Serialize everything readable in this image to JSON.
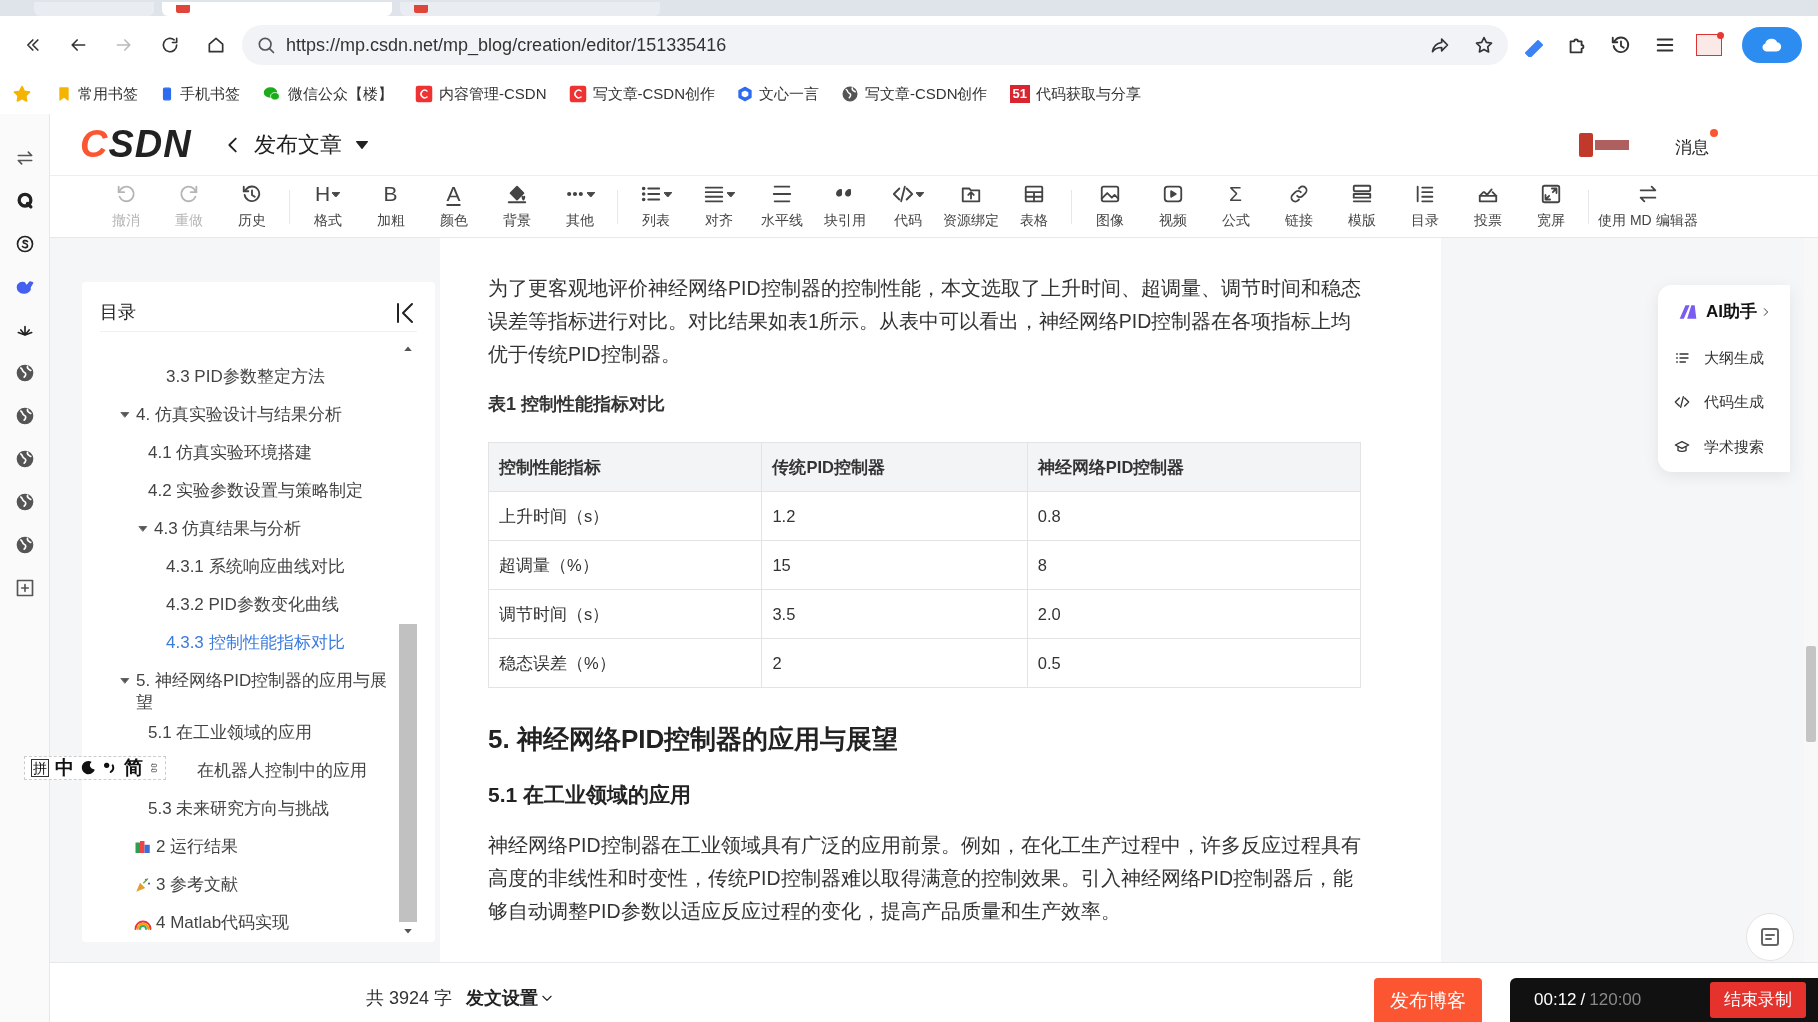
{
  "browser": {
    "tabs": [
      {
        "selected": false
      },
      {
        "selected": true
      },
      {
        "selected": false
      }
    ],
    "url": "https://mp.csdn.net/mp_blog/creation/editor/151335416",
    "bookmarks": [
      {
        "label": "常用书签",
        "kind": "star"
      },
      {
        "label": "手机书签",
        "kind": "phone"
      },
      {
        "label": "微信公众【楼】",
        "kind": "wechat"
      },
      {
        "label": "内容管理-CSDN",
        "kind": "csdn"
      },
      {
        "label": "写文章-CSDN创作",
        "kind": "csdn"
      },
      {
        "label": "文心一言",
        "kind": "cube"
      },
      {
        "label": "写文章-CSDN创作",
        "kind": "globe"
      },
      {
        "label": "代码获取与分享",
        "kind": "badge",
        "badge_text": "51"
      }
    ]
  },
  "header": {
    "logo": "CSDN",
    "title": "发布文章",
    "messages": "消息",
    "unread": true
  },
  "toolbar": [
    {
      "kind": "button",
      "label": "撤消",
      "disabled": true,
      "dropdown": false
    },
    {
      "kind": "button",
      "label": "重做",
      "disabled": true,
      "dropdown": false
    },
    {
      "kind": "button",
      "label": "历史",
      "disabled": false,
      "dropdown": false
    },
    {
      "kind": "separator"
    },
    {
      "kind": "button",
      "label": "格式",
      "glyph": "H",
      "disabled": false,
      "dropdown": true
    },
    {
      "kind": "button",
      "label": "加粗",
      "glyph": "B",
      "disabled": false,
      "dropdown": false
    },
    {
      "kind": "button",
      "label": "颜色",
      "glyph": "A",
      "disabled": false,
      "dropdown": false
    },
    {
      "kind": "button",
      "label": "背景",
      "disabled": false,
      "dropdown": false
    },
    {
      "kind": "button",
      "label": "其他",
      "disabled": false,
      "dropdown": true
    },
    {
      "kind": "separator"
    },
    {
      "kind": "button",
      "label": "列表",
      "disabled": false,
      "dropdown": true
    },
    {
      "kind": "button",
      "label": "对齐",
      "disabled": false,
      "dropdown": true
    },
    {
      "kind": "button",
      "label": "水平线",
      "disabled": false,
      "dropdown": false
    },
    {
      "kind": "button",
      "label": "块引用",
      "disabled": false,
      "dropdown": false
    },
    {
      "kind": "button",
      "label": "代码",
      "disabled": false,
      "dropdown": true
    },
    {
      "kind": "button",
      "label": "资源绑定",
      "disabled": false,
      "dropdown": false
    },
    {
      "kind": "button",
      "label": "表格",
      "disabled": false,
      "dropdown": false
    },
    {
      "kind": "separator"
    },
    {
      "kind": "button",
      "label": "图像",
      "disabled": false,
      "dropdown": false
    },
    {
      "kind": "button",
      "label": "视频",
      "disabled": false,
      "dropdown": false
    },
    {
      "kind": "button",
      "label": "公式",
      "glyph": "Σ",
      "disabled": false,
      "dropdown": false
    },
    {
      "kind": "button",
      "label": "链接",
      "disabled": false,
      "dropdown": false
    },
    {
      "kind": "button",
      "label": "模版",
      "disabled": false,
      "dropdown": false
    },
    {
      "kind": "button",
      "label": "目录",
      "disabled": false,
      "dropdown": false
    },
    {
      "kind": "button",
      "label": "投票",
      "disabled": false,
      "dropdown": false
    },
    {
      "kind": "button",
      "label": "宽屏",
      "disabled": false,
      "dropdown": false
    },
    {
      "kind": "separator"
    },
    {
      "kind": "button",
      "label": "使用 MD 编辑器",
      "disabled": false,
      "dropdown": false
    }
  ],
  "toc": {
    "title": "目录",
    "items": [
      {
        "label": "3.3 PID参数整定方法",
        "kind": "continued",
        "selected": false
      },
      {
        "label": "4. 仿真实验设计与结果分析",
        "selected": false,
        "expanded": true,
        "children": [
          {
            "label": "4.1 仿真实验环境搭建",
            "selected": false
          },
          {
            "label": "4.2 实验参数设置与策略制定",
            "selected": false
          },
          {
            "label": "4.3 仿真结果与分析",
            "selected": false,
            "expanded": true,
            "children": [
              {
                "label": "4.3.1 系统响应曲线对比",
                "selected": false
              },
              {
                "label": "4.3.2 PID参数变化曲线",
                "selected": false
              },
              {
                "label": "4.3.3 控制性能指标对比",
                "selected": true
              }
            ]
          }
        ]
      },
      {
        "label": "5. 神经网络PID控制器的应用与展望",
        "selected": false,
        "expanded": true,
        "children": [
          {
            "label": "5.1 在工业领域的应用",
            "selected": false
          },
          {
            "label": "在机器人控制中的应用",
            "kind": "covered",
            "selected": false
          },
          {
            "label": "5.3 未来研究方向与挑战",
            "selected": false
          }
        ]
      },
      {
        "label": "2 运行结果",
        "kind": "books",
        "selected": false
      },
      {
        "label": "3 参考文献",
        "kind": "party",
        "selected": false
      },
      {
        "label": "4 Matlab代码实现",
        "kind": "rainbow",
        "selected": false
      }
    ]
  },
  "ime_bar": [
    "拼",
    "中",
    "简"
  ],
  "article": {
    "paragraph_1": "为了更客观地评价神经网络PID控制器的控制性能，本文选取了上升时间、超调量、调节时间和稳态误差等指标进行对比。对比结果如表1所示。从表中可以看出，神经网络PID控制器在各项指标上均优于传统PID控制器。",
    "table_caption": "表1 控制性能指标对比",
    "table": {
      "columns": [
        "控制性能指标",
        "传统PID控制器",
        "神经网络PID控制器"
      ],
      "rows": [
        [
          "上升时间（s）",
          "1.2",
          "0.8"
        ],
        [
          "超调量（%）",
          "15",
          "8"
        ],
        [
          "调节时间（s）",
          "3.5",
          "2.0"
        ],
        [
          "稳态误差（%）",
          "2",
          "0.5"
        ]
      ]
    },
    "heading_2": "5. 神经网络PID控制器的应用与展望",
    "heading_3": "5.1 在工业领域的应用",
    "paragraph_2": "神经网络PID控制器在工业领域具有广泛的应用前景。例如，在化工生产过程中，许多反应过程具有高度的非线性和时变性，传统PID控制器难以取得满意的控制效果。引入神经网络PID控制器后，能够自动调整PID参数以适应反应过程的变化，提高产品质量和生产效率。"
  },
  "ai_panel": {
    "title": "AI助手",
    "items": [
      {
        "label": "大纲生成",
        "kind": "outline"
      },
      {
        "label": "代码生成",
        "kind": "code"
      },
      {
        "label": "学术搜索",
        "kind": "scholar"
      }
    ]
  },
  "footer": {
    "word_count": "共 3924 字",
    "settings": "发文设置",
    "publish": "发布博客"
  },
  "recorder": {
    "elapsed": "00:12",
    "separator": "/",
    "limit": "120:00",
    "stop": "结束录制"
  }
}
